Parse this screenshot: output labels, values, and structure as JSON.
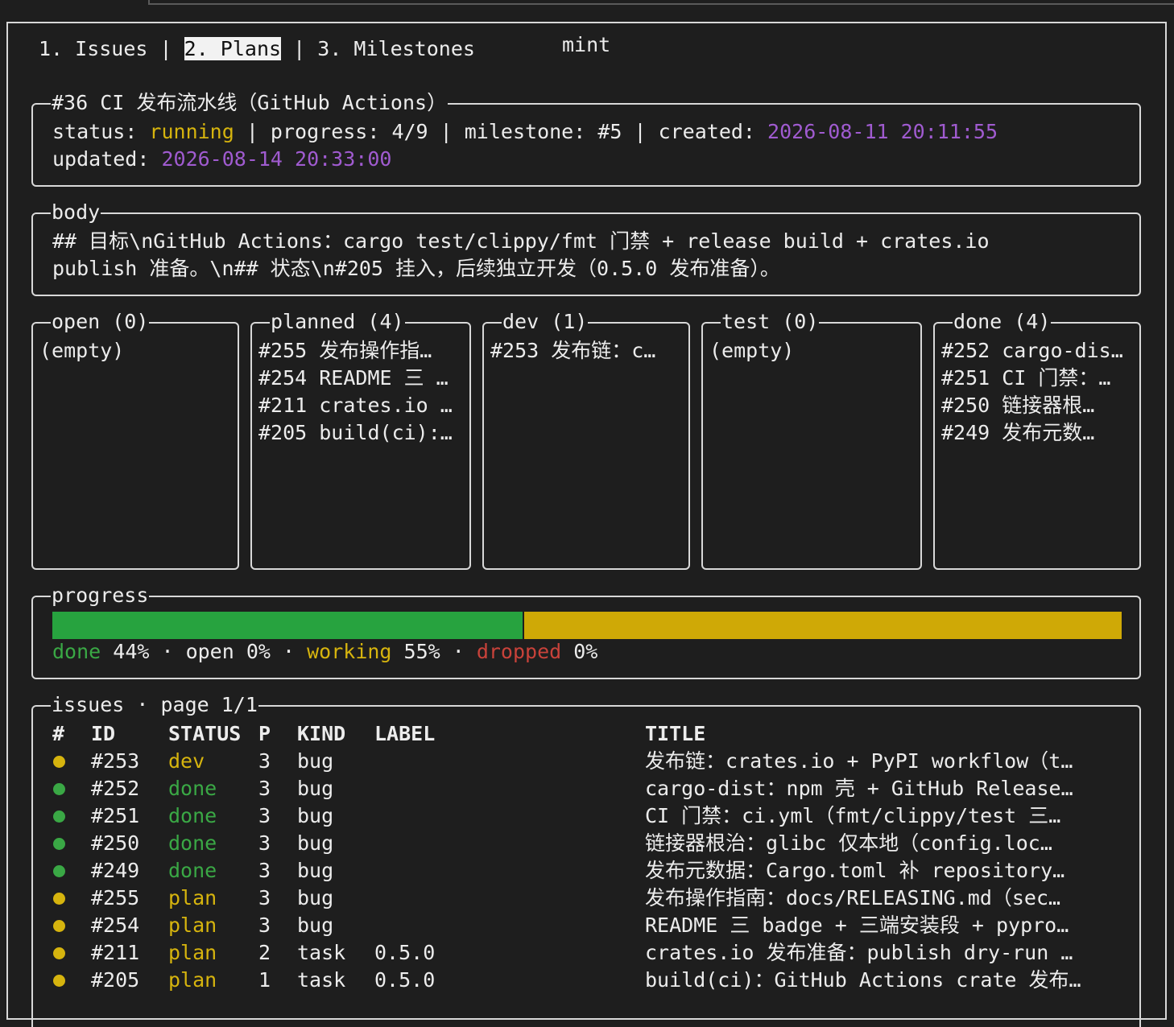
{
  "app_title": "mint",
  "tabs": [
    {
      "label": "1. Issues",
      "active": false
    },
    {
      "label": "2. Plans",
      "active": true
    },
    {
      "label": "3. Milestones",
      "active": false
    }
  ],
  "tab_separator": "|",
  "plan": {
    "title": "#36 CI 发布流水线（GitHub Actions）",
    "status_label": "status: ",
    "status": "running",
    "progress_text": " | progress: 4/9 | milestone: #5 | created: ",
    "created": "2026-08-11 20:11:55",
    "updated_label": "updated: ",
    "updated": "2026-08-14 20:33:00"
  },
  "body": {
    "title": "body",
    "line1": "## 目标\\nGitHub Actions：cargo test/clippy/fmt 门禁 + release build + crates.io",
    "line2": "publish 准备。\\n## 状态\\n#205 挂入，后续独立开发（0.5.0 发布准备）。"
  },
  "columns": [
    {
      "title": "open (0)",
      "items": [
        "(empty)"
      ]
    },
    {
      "title": "planned (4)",
      "items": [
        "#255 发布操作指…",
        "#254 README 三 …",
        "#211 crates.io …",
        "#205 build(ci):…"
      ]
    },
    {
      "title": "dev (1)",
      "items": [
        "#253 发布链：c…"
      ]
    },
    {
      "title": "test (0)",
      "items": [
        "(empty)"
      ]
    },
    {
      "title": "done (4)",
      "items": [
        "#252 cargo-dis…",
        "#251 CI 门禁：…",
        "#250 链接器根…",
        "#249 发布元数…"
      ]
    }
  ],
  "progress": {
    "title": "progress",
    "done_fraction": 0.44,
    "working_fraction": 0.55,
    "legend": {
      "done_label": "done",
      "done_value": " 44% · ",
      "open_label": "open",
      "open_value": " 0% · ",
      "working_label": "working",
      "working_value": " 55% · ",
      "dropped_label": "dropped",
      "dropped_value": " 0%"
    },
    "colors": {
      "done": "#27a33f",
      "working": "#cfa906",
      "dropped": "#c8423a"
    }
  },
  "issues": {
    "title": "issues · page 1/1",
    "headers": {
      "num": "#",
      "id": "ID",
      "status": "STATUS",
      "p": "P",
      "kind": "KIND",
      "label": "LABEL",
      "title": "TITLE"
    },
    "rows": [
      {
        "dot": "#d6b40e",
        "id": "#253",
        "status": "dev",
        "status_color": "#d6b40e",
        "p": "3",
        "kind": "bug",
        "label": "",
        "title": "发布链：crates.io + PyPI workflow（t…"
      },
      {
        "dot": "#3aa845",
        "id": "#252",
        "status": "done",
        "status_color": "#3aa845",
        "p": "3",
        "kind": "bug",
        "label": "",
        "title": "cargo-dist：npm 壳 + GitHub Release…"
      },
      {
        "dot": "#3aa845",
        "id": "#251",
        "status": "done",
        "status_color": "#3aa845",
        "p": "3",
        "kind": "bug",
        "label": "",
        "title": "CI 门禁：ci.yml（fmt/clippy/test 三…"
      },
      {
        "dot": "#3aa845",
        "id": "#250",
        "status": "done",
        "status_color": "#3aa845",
        "p": "3",
        "kind": "bug",
        "label": "",
        "title": "链接器根治：glibc 仅本地（config.loc…"
      },
      {
        "dot": "#3aa845",
        "id": "#249",
        "status": "done",
        "status_color": "#3aa845",
        "p": "3",
        "kind": "bug",
        "label": "",
        "title": "发布元数据：Cargo.toml 补 repository…"
      },
      {
        "dot": "#d6b40e",
        "id": "#255",
        "status": "plan",
        "status_color": "#d6b40e",
        "p": "3",
        "kind": "bug",
        "label": "",
        "title": "发布操作指南：docs/RELEASING.md（sec…"
      },
      {
        "dot": "#d6b40e",
        "id": "#254",
        "status": "plan",
        "status_color": "#d6b40e",
        "p": "3",
        "kind": "bug",
        "label": "",
        "title": "README 三 badge + 三端安装段 + pypro…"
      },
      {
        "dot": "#d6b40e",
        "id": "#211",
        "status": "plan",
        "status_color": "#d6b40e",
        "p": "2",
        "kind": "task",
        "label": "0.5.0",
        "title": "crates.io 发布准备：publish dry-run …"
      },
      {
        "dot": "#d6b40e",
        "id": "#205",
        "status": "plan",
        "status_color": "#d6b40e",
        "p": "1",
        "kind": "task",
        "label": "0.5.0",
        "title": "build(ci)：GitHub Actions crate 发布…"
      }
    ]
  }
}
